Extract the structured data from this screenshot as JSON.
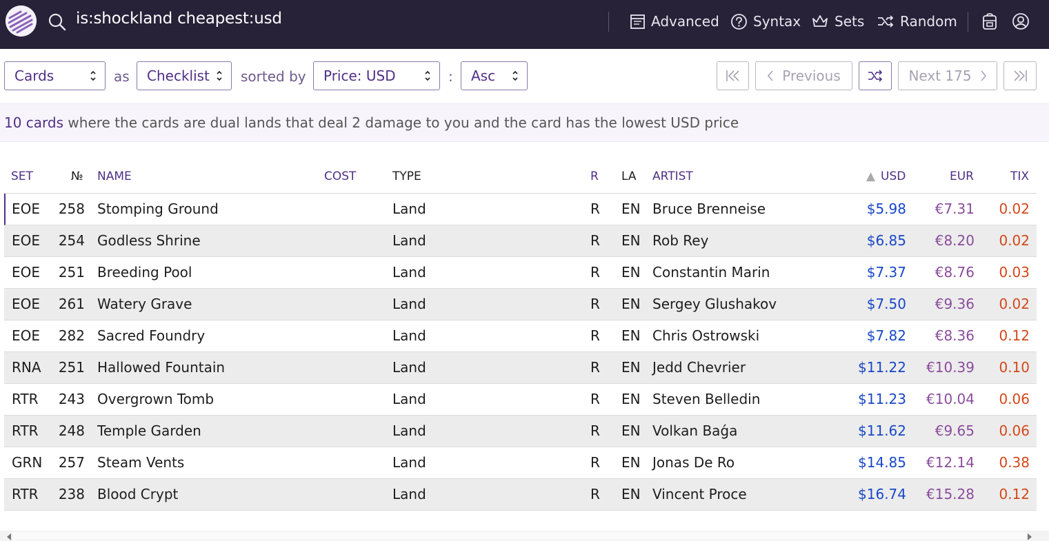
{
  "header": {
    "search_query": "is:shockland cheapest:usd",
    "nav": [
      {
        "label": "Advanced",
        "icon": "advanced-search-icon"
      },
      {
        "label": "Syntax",
        "icon": "help-circle-icon"
      },
      {
        "label": "Sets",
        "icon": "crown-icon"
      },
      {
        "label": "Random",
        "icon": "shuffle-icon"
      }
    ],
    "icons": [
      "logo-icon",
      "search-icon",
      "deck-bag-icon",
      "account-icon"
    ]
  },
  "controls": {
    "display_select": "Cards",
    "as_text": "as",
    "format_select": "Checklist",
    "sorted_by_text": "sorted by",
    "order_select": "Price: USD",
    "colon_text": ":",
    "direction_select": "Asc",
    "previous_label": "Previous",
    "next_label": "Next 175"
  },
  "summary": {
    "count": "10 cards",
    "description": " where the cards are dual lands that deal 2 damage to you and the card has the lowest USD price"
  },
  "table": {
    "columns": {
      "set": "SET",
      "number": "№",
      "name": "NAME",
      "cost": "COST",
      "type": "TYPE",
      "rarity": "R",
      "lang": "LA",
      "artist": "ARTIST",
      "usd": "USD",
      "eur": "EUR",
      "tix": "TIX"
    },
    "sort_indicator": "▲",
    "rows": [
      {
        "set": "EOE",
        "number": "258",
        "name": "Stomping Ground",
        "cost": "",
        "type": "Land",
        "rarity": "R",
        "lang": "EN",
        "artist": "Bruce Brenneise",
        "usd": "$5.98",
        "eur": "€7.31",
        "tix": "0.02"
      },
      {
        "set": "EOE",
        "number": "254",
        "name": "Godless Shrine",
        "cost": "",
        "type": "Land",
        "rarity": "R",
        "lang": "EN",
        "artist": "Rob Rey",
        "usd": "$6.85",
        "eur": "€8.20",
        "tix": "0.02"
      },
      {
        "set": "EOE",
        "number": "251",
        "name": "Breeding Pool",
        "cost": "",
        "type": "Land",
        "rarity": "R",
        "lang": "EN",
        "artist": "Constantin Marin",
        "usd": "$7.37",
        "eur": "€8.76",
        "tix": "0.03"
      },
      {
        "set": "EOE",
        "number": "261",
        "name": "Watery Grave",
        "cost": "",
        "type": "Land",
        "rarity": "R",
        "lang": "EN",
        "artist": "Sergey Glushakov",
        "usd": "$7.50",
        "eur": "€9.36",
        "tix": "0.02"
      },
      {
        "set": "EOE",
        "number": "282",
        "name": "Sacred Foundry",
        "cost": "",
        "type": "Land",
        "rarity": "R",
        "lang": "EN",
        "artist": "Chris Ostrowski",
        "usd": "$7.82",
        "eur": "€8.36",
        "tix": "0.12"
      },
      {
        "set": "RNA",
        "number": "251",
        "name": "Hallowed Fountain",
        "cost": "",
        "type": "Land",
        "rarity": "R",
        "lang": "EN",
        "artist": "Jedd Chevrier",
        "usd": "$11.22",
        "eur": "€10.39",
        "tix": "0.10"
      },
      {
        "set": "RTR",
        "number": "243",
        "name": "Overgrown Tomb",
        "cost": "",
        "type": "Land",
        "rarity": "R",
        "lang": "EN",
        "artist": "Steven Belledin",
        "usd": "$11.23",
        "eur": "€10.04",
        "tix": "0.06"
      },
      {
        "set": "RTR",
        "number": "248",
        "name": "Temple Garden",
        "cost": "",
        "type": "Land",
        "rarity": "R",
        "lang": "EN",
        "artist": "Volkan Baǵa",
        "usd": "$11.62",
        "eur": "€9.65",
        "tix": "0.06"
      },
      {
        "set": "GRN",
        "number": "257",
        "name": "Steam Vents",
        "cost": "",
        "type": "Land",
        "rarity": "R",
        "lang": "EN",
        "artist": "Jonas De Ro",
        "usd": "$14.85",
        "eur": "€12.14",
        "tix": "0.38"
      },
      {
        "set": "RTR",
        "number": "238",
        "name": "Blood Crypt",
        "cost": "",
        "type": "Land",
        "rarity": "R",
        "lang": "EN",
        "artist": "Vincent Proce",
        "usd": "$16.74",
        "eur": "€15.28",
        "tix": "0.12"
      }
    ]
  },
  "colors": {
    "header_bg": "#272238",
    "accent": "#4f2f86",
    "usd": "#1747c8",
    "eur": "#8a4c9c",
    "tix": "#d3481a"
  }
}
